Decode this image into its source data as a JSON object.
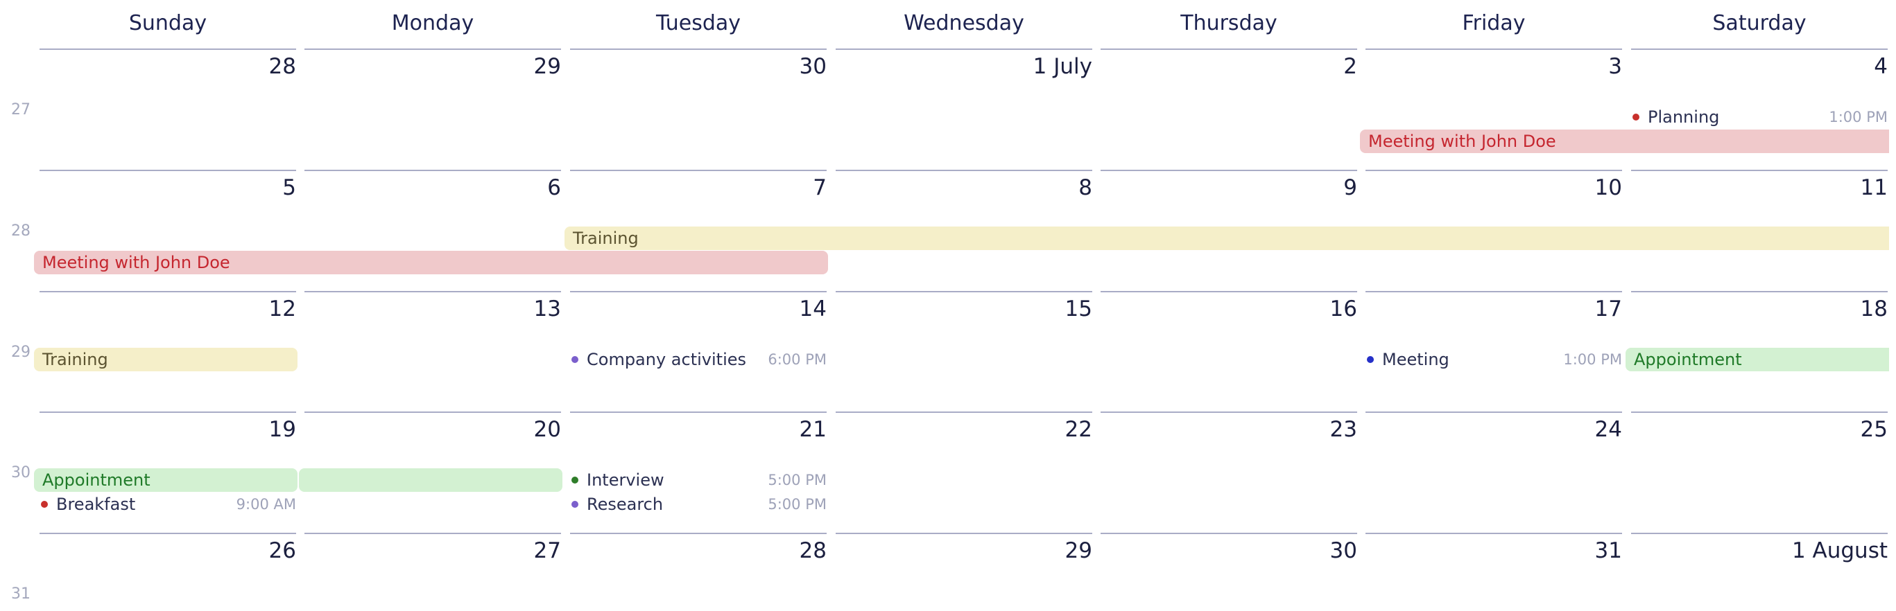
{
  "weekdays": [
    "Sunday",
    "Monday",
    "Tuesday",
    "Wednesday",
    "Thursday",
    "Friday",
    "Saturday"
  ],
  "weeks": [
    {
      "number": "27",
      "dates": [
        "28",
        "29",
        "30",
        "1 July",
        "2",
        "3",
        "4"
      ]
    },
    {
      "number": "28",
      "dates": [
        "5",
        "6",
        "7",
        "8",
        "9",
        "10",
        "11"
      ]
    },
    {
      "number": "29",
      "dates": [
        "12",
        "13",
        "14",
        "15",
        "16",
        "17",
        "18"
      ]
    },
    {
      "number": "30",
      "dates": [
        "19",
        "20",
        "21",
        "22",
        "23",
        "24",
        "25"
      ]
    },
    {
      "number": "31",
      "dates": [
        "26",
        "27",
        "28",
        "29",
        "30",
        "31",
        "1 August"
      ]
    }
  ],
  "colors": {
    "red_bg": "#f0c9cb",
    "red_text": "#c5262f",
    "yellow_bg": "#f5efc9",
    "yellow_text": "#5b5330",
    "green_bg": "#d3f1d2",
    "green_text": "#1f7a28",
    "dot_red": "#c8302c",
    "dot_purple": "#7b5fcc",
    "dot_blue": "#2530c8",
    "dot_green": "#2f7d2a"
  },
  "events": [
    {
      "type": "bar",
      "title": "Meeting with John Doe",
      "week": 0,
      "start": 5,
      "end": 6,
      "lane": 1,
      "color": "red",
      "open_end": true
    },
    {
      "type": "bar",
      "title": "Meeting with John Doe",
      "week": 1,
      "start": 0,
      "end": 2,
      "lane": 1,
      "color": "red"
    },
    {
      "type": "bar",
      "title": "Training",
      "week": 1,
      "start": 2,
      "end": 6,
      "lane": 0,
      "color": "yellow",
      "open_end": true
    },
    {
      "type": "bar",
      "title": "Training",
      "week": 2,
      "start": 0,
      "end": 0,
      "lane": 0,
      "color": "yellow"
    },
    {
      "type": "bar",
      "title": "Appointment",
      "week": 2,
      "start": 6,
      "end": 6,
      "lane": 0,
      "color": "green",
      "open_end": true
    },
    {
      "type": "bar",
      "title": "Appointment",
      "week": 3,
      "start": 0,
      "end": 0,
      "lane": 0,
      "color": "green"
    },
    {
      "type": "bar",
      "title": "",
      "week": 3,
      "start": 1,
      "end": 1,
      "lane": 0,
      "color": "green"
    },
    {
      "type": "dot",
      "title": "Planning",
      "time": "1:00 PM",
      "week": 0,
      "day": 6,
      "lane": 0,
      "dot": "dot_red"
    },
    {
      "type": "dot",
      "title": "Company activities",
      "time": "6:00 PM",
      "week": 2,
      "day": 2,
      "lane": 0,
      "dot": "dot_purple"
    },
    {
      "type": "dot",
      "title": "Meeting",
      "time": "1:00 PM",
      "week": 2,
      "day": 5,
      "lane": 0,
      "dot": "dot_blue"
    },
    {
      "type": "dot",
      "title": "Breakfast",
      "time": "9:00 AM",
      "week": 3,
      "day": 0,
      "lane": 1,
      "dot": "dot_red"
    },
    {
      "type": "dot",
      "title": "Interview",
      "time": "5:00 PM",
      "week": 3,
      "day": 2,
      "lane": 0,
      "dot": "dot_green"
    },
    {
      "type": "dot",
      "title": "Research",
      "time": "5:00 PM",
      "week": 3,
      "day": 2,
      "lane": 1,
      "dot": "dot_purple"
    }
  ]
}
